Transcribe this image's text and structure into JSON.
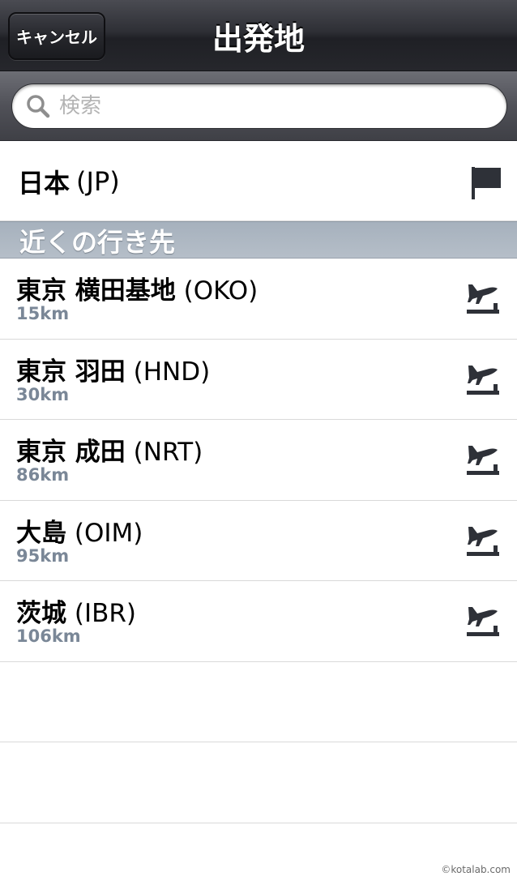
{
  "navbar": {
    "cancel_label": "キャンセル",
    "title": "出発地"
  },
  "search": {
    "placeholder": "検索",
    "value": ""
  },
  "country": {
    "name": "日本",
    "code": "(JP)",
    "icon": "flag-icon"
  },
  "section": {
    "title": "近くの行き先"
  },
  "airports": [
    {
      "name": "東京 横田基地",
      "code": "(OKO)",
      "distance": "15km",
      "icon": "airplane-departure-icon"
    },
    {
      "name": "東京 羽田",
      "code": "(HND)",
      "distance": "30km",
      "icon": "airplane-departure-icon"
    },
    {
      "name": "東京 成田",
      "code": "(NRT)",
      "distance": "86km",
      "icon": "airplane-departure-icon"
    },
    {
      "name": "大島",
      "code": "(OIM)",
      "distance": "95km",
      "icon": "airplane-departure-icon"
    },
    {
      "name": "茨城",
      "code": "(IBR)",
      "distance": "106km",
      "icon": "airplane-departure-icon"
    }
  ],
  "watermark": "©kotalab.com",
  "colors": {
    "distance_text": "#7a8797",
    "section_header": "#b5bec8",
    "navbar": "#2e2f35"
  }
}
